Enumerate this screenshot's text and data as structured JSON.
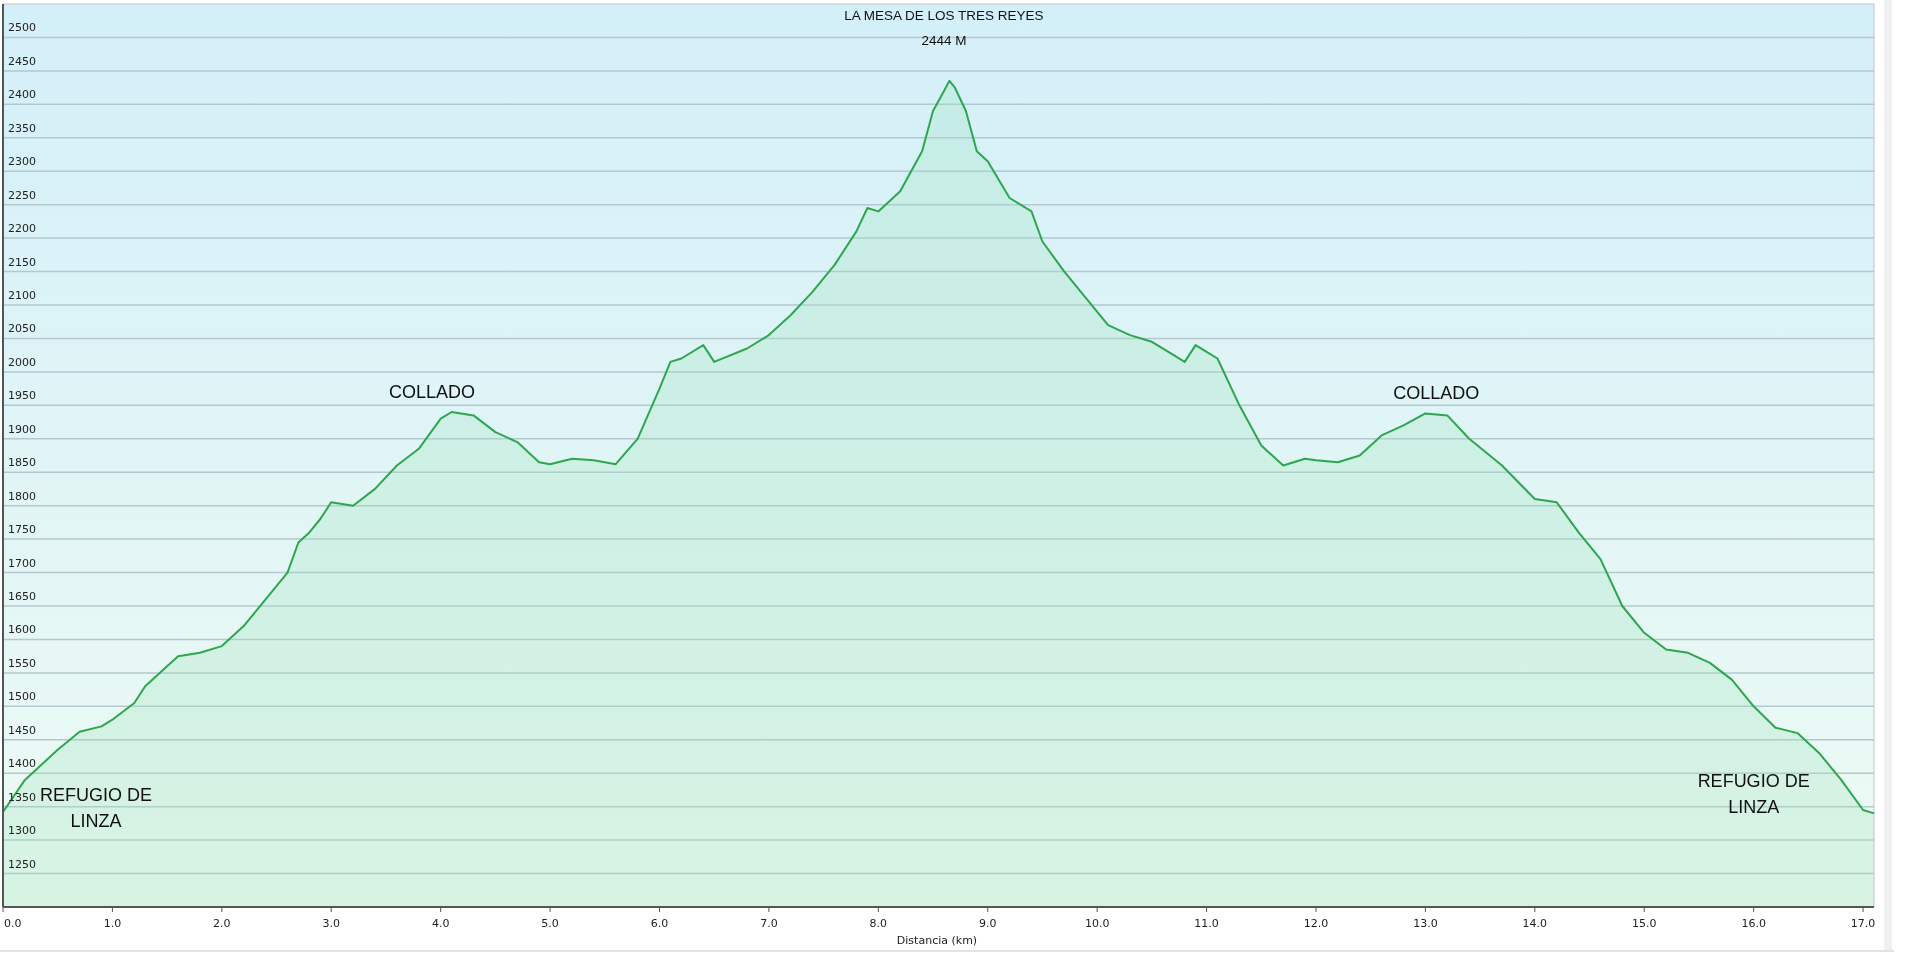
{
  "elevation_profile": {
    "chart_data": {
      "type": "area",
      "xlabel": "Distancia (km)",
      "xlim": [
        0,
        17.1
      ],
      "ylim": [
        1200,
        2550
      ],
      "xticks": [
        {
          "value": 0,
          "label": "0.0"
        },
        {
          "value": 1,
          "label": "1.0"
        },
        {
          "value": 2,
          "label": "2.0"
        },
        {
          "value": 3,
          "label": "3.0"
        },
        {
          "value": 4,
          "label": "4.0"
        },
        {
          "value": 5,
          "label": "5.0"
        },
        {
          "value": 6,
          "label": "6.0"
        },
        {
          "value": 7,
          "label": "7.0"
        },
        {
          "value": 8,
          "label": "8.0"
        },
        {
          "value": 9,
          "label": "9.0"
        },
        {
          "value": 10,
          "label": "10.0"
        },
        {
          "value": 11,
          "label": "11.0"
        },
        {
          "value": 12,
          "label": "12.0"
        },
        {
          "value": 13,
          "label": "13.0"
        },
        {
          "value": 14,
          "label": "14.0"
        },
        {
          "value": 15,
          "label": "15.0"
        },
        {
          "value": 16,
          "label": "16.0"
        },
        {
          "value": 17,
          "label": "17.0"
        }
      ],
      "yticks": [
        1250,
        1300,
        1350,
        1400,
        1450,
        1500,
        1550,
        1600,
        1650,
        1700,
        1750,
        1800,
        1850,
        1900,
        1950,
        2000,
        2050,
        2100,
        2150,
        2200,
        2250,
        2300,
        2350,
        2400,
        2450,
        2500
      ],
      "x": [
        0,
        0.2,
        0.5,
        0.7,
        0.9,
        1.0,
        1.2,
        1.3,
        1.5,
        1.6,
        1.8,
        2.0,
        2.2,
        2.4,
        2.6,
        2.7,
        2.8,
        2.9,
        3.0,
        3.2,
        3.4,
        3.6,
        3.8,
        4.0,
        4.1,
        4.3,
        4.5,
        4.7,
        4.9,
        5.0,
        5.2,
        5.4,
        5.6,
        5.8,
        6.0,
        6.1,
        6.2,
        6.4,
        6.5,
        6.8,
        7.0,
        7.2,
        7.4,
        7.6,
        7.8,
        7.9,
        8.0,
        8.2,
        8.4,
        8.5,
        8.6,
        8.65,
        8.7,
        8.8,
        8.9,
        9.0,
        9.2,
        9.4,
        9.5,
        9.7,
        9.9,
        10.1,
        10.3,
        10.5,
        10.7,
        10.8,
        10.9,
        11.0,
        11.1,
        11.3,
        11.5,
        11.7,
        11.9,
        12.0,
        12.2,
        12.4,
        12.6,
        12.8,
        13.0,
        13.2,
        13.4,
        13.7,
        14.0,
        14.2,
        14.4,
        14.6,
        14.8,
        15.0,
        15.2,
        15.4,
        15.6,
        15.8,
        16.0,
        16.2,
        16.4,
        16.6,
        16.8,
        17.0,
        17.1
      ],
      "series": [
        {
          "color": "#2ea64f",
          "values": [
            1342,
            1390,
            1435,
            1462,
            1470,
            1480,
            1505,
            1530,
            1560,
            1575,
            1580,
            1590,
            1620,
            1660,
            1700,
            1745,
            1760,
            1780,
            1805,
            1800,
            1825,
            1860,
            1885,
            1930,
            1940,
            1935,
            1910,
            1895,
            1865,
            1862,
            1870,
            1868,
            1862,
            1900,
            1975,
            2015,
            2020,
            2040,
            2015,
            2035,
            2055,
            2085,
            2120,
            2160,
            2210,
            2245,
            2240,
            2270,
            2330,
            2390,
            2420,
            2435,
            2425,
            2390,
            2330,
            2315,
            2260,
            2240,
            2195,
            2150,
            2110,
            2070,
            2055,
            2045,
            2025,
            2015,
            2040,
            2030,
            2020,
            1950,
            1890,
            1860,
            1870,
            1868,
            1865,
            1875,
            1905,
            1920,
            1938,
            1935,
            1900,
            1860,
            1810,
            1805,
            1760,
            1720,
            1650,
            1610,
            1585,
            1580,
            1565,
            1540,
            1500,
            1468,
            1460,
            1430,
            1390,
            1345,
            1340
          ]
        }
      ],
      "grid": true,
      "annotations": [
        "LA MESA DE LOS TRES REYES",
        "2444 M",
        "COLLADO",
        "COLLADO",
        "REFUGIO DE",
        "LINZA",
        "REFUGIO DE",
        "LINZA"
      ]
    }
  }
}
